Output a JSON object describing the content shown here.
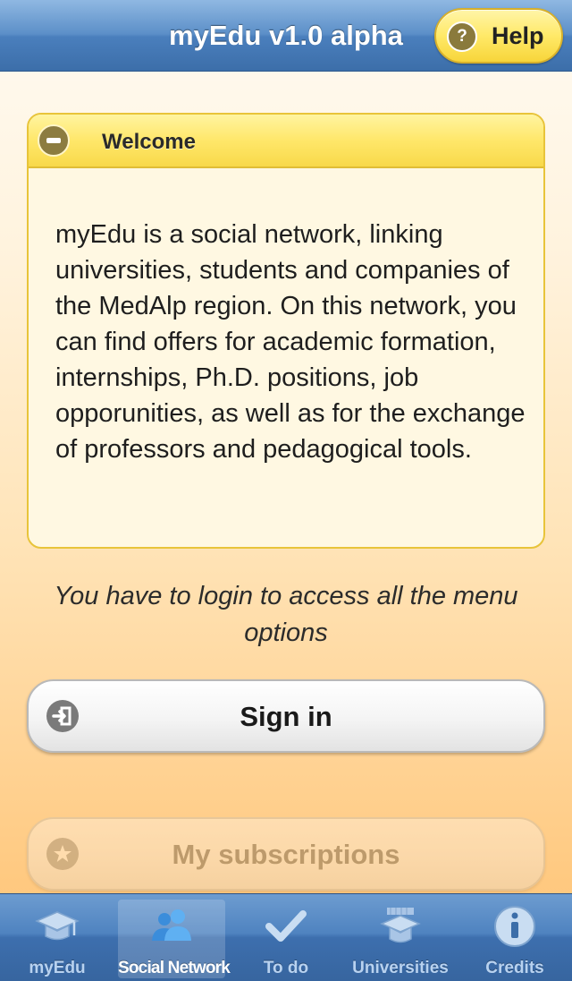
{
  "header": {
    "title": "myEdu v1.0 alpha",
    "help_label": "Help",
    "help_icon": "question-icon"
  },
  "welcome": {
    "title": "Welcome",
    "icon": "minus-icon",
    "body": "myEdu is a social network, linking universities, students and companies of the MedAlp region. On this network, you can find offers for academic formation, internships, Ph.D. positions, job opporunities, as well as for the exchange of professors and pedagogical tools."
  },
  "login_note": "You have to login to access all the menu options",
  "buttons": {
    "signin_label": "Sign in",
    "signin_icon": "sign-in-icon",
    "subscriptions_label": "My subscriptions",
    "subscriptions_icon": "star-icon"
  },
  "tabs": [
    {
      "label": "myEdu",
      "icon": "graduation-cap-icon",
      "active": false
    },
    {
      "label": "Social Network",
      "icon": "people-icon",
      "active": true
    },
    {
      "label": "To do",
      "icon": "checkmark-icon",
      "active": false
    },
    {
      "label": "Universities",
      "icon": "universities-icon",
      "active": false
    },
    {
      "label": "Credits",
      "icon": "info-icon",
      "active": false
    }
  ],
  "colors": {
    "header_blue": "#4a7fbd",
    "accent_yellow": "#ffe968",
    "tab_active_label": "#ffffff",
    "tab_inactive_label": "#b8d2f0"
  }
}
